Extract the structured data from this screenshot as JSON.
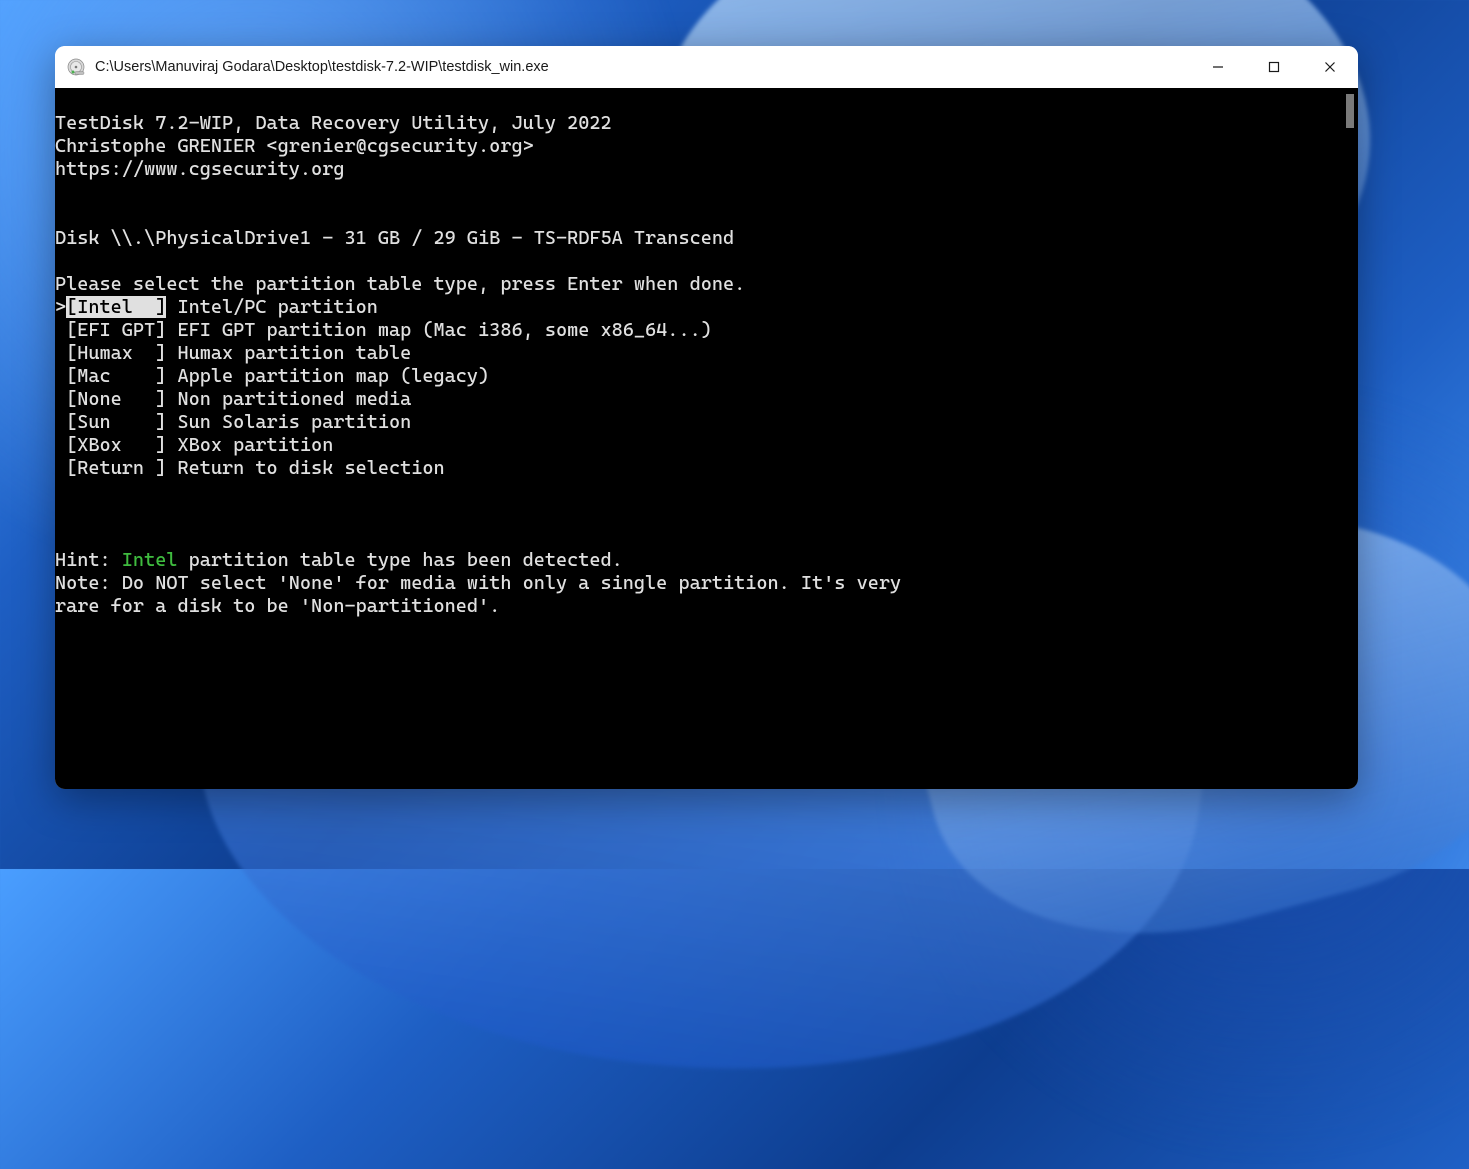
{
  "window": {
    "title": "C:\\Users\\Manuviraj Godara\\Desktop\\testdisk-7.2-WIP\\testdisk_win.exe"
  },
  "terminal": {
    "header_line1": "TestDisk 7.2-WIP, Data Recovery Utility, July 2022",
    "header_line2": "Christophe GRENIER <grenier@cgsecurity.org>",
    "header_line3": "https://www.cgsecurity.org",
    "disk_line": "Disk \\\\.\\PhysicalDrive1 - 31 GB / 29 GiB - TS-RDF5A Transcend",
    "instruction": "Please select the partition table type, press Enter when done.",
    "options": [
      {
        "key": "[Intel  ]",
        "label": " Intel/PC partition",
        "selected": true
      },
      {
        "key": " [EFI GPT]",
        "label": " EFI GPT partition map (Mac i386, some x86_64...)",
        "selected": false
      },
      {
        "key": " [Humax  ]",
        "label": " Humax partition table",
        "selected": false
      },
      {
        "key": " [Mac    ]",
        "label": " Apple partition map (legacy)",
        "selected": false
      },
      {
        "key": " [None   ]",
        "label": " Non partitioned media",
        "selected": false
      },
      {
        "key": " [Sun    ]",
        "label": " Sun Solaris partition",
        "selected": false
      },
      {
        "key": " [XBox   ]",
        "label": " XBox partition",
        "selected": false
      },
      {
        "key": " [Return ]",
        "label": " Return to disk selection",
        "selected": false
      }
    ],
    "hint_prefix": "Hint: ",
    "hint_detected": "Intel",
    "hint_suffix": " partition table type has been detected.",
    "note_line1": "Note: Do NOT select 'None' for media with only a single partition. It's very",
    "note_line2": "rare for a disk to be 'Non-partitioned'."
  }
}
